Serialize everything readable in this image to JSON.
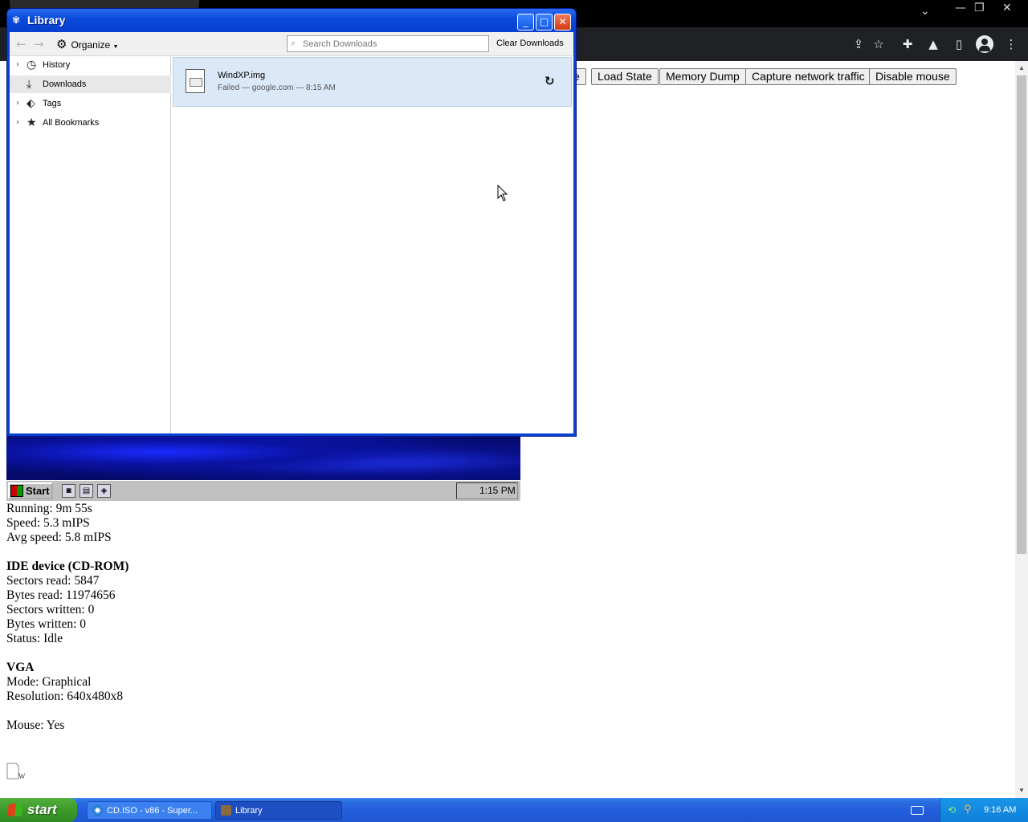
{
  "browser": {
    "icons": [
      "share-icon",
      "star-icon",
      "extensions-icon",
      "lab-icon",
      "side-panel-icon",
      "profile-icon",
      "menu-icon"
    ]
  },
  "page": {
    "buttons": [
      {
        "label": "e"
      },
      {
        "label": "Load State"
      },
      {
        "label": "Memory Dump"
      },
      {
        "label": "Capture network traffic"
      },
      {
        "label": "Disable mouse"
      }
    ],
    "stats": {
      "running": "Running: 9m 55s",
      "speed": "Speed: 5.3 mIPS",
      "avg_speed": "Avg speed: 5.8 mIPS",
      "ide_heading": "IDE device (CD-ROM)",
      "sectors_read": "Sectors read: 5847",
      "bytes_read": "Bytes read: 11974656",
      "sectors_written": "Sectors written: 0",
      "bytes_written": "Bytes written: 0",
      "status": "Status: Idle",
      "vga_heading": "VGA",
      "mode": "Mode: Graphical",
      "resolution": "Resolution: 640x480x8",
      "mouse": "Mouse: Yes"
    },
    "broken_image_text": "W"
  },
  "emulator": {
    "start_label": "Start",
    "clock": "1:15 PM"
  },
  "library": {
    "title": "Library",
    "organize_label": "Organize",
    "search_placeholder": "Search Downloads",
    "clear_label": "Clear Downloads",
    "sidebar": [
      {
        "label": "History",
        "icon": "clock-icon",
        "has_twisty": true
      },
      {
        "label": "Downloads",
        "icon": "download-icon",
        "has_twisty": false,
        "selected": true
      },
      {
        "label": "Tags",
        "icon": "tag-icon",
        "has_twisty": true
      },
      {
        "label": "All Bookmarks",
        "icon": "star-icon",
        "has_twisty": true
      }
    ],
    "download": {
      "filename": "WindXP.img",
      "status": "Failed — google.com — 8:15 AM"
    }
  },
  "taskbar": {
    "start_label": "start",
    "tasks": [
      {
        "label": "CD.ISO - v86 - Super..."
      },
      {
        "label": "Library"
      }
    ],
    "clock": "9:16 AM"
  }
}
